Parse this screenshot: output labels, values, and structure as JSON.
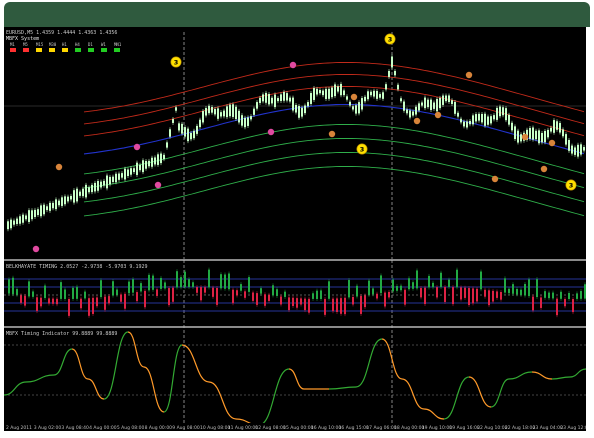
{
  "window": {
    "titlebar_color": "#2f5a3e"
  },
  "main_chart": {
    "symbol_line": "EURUSD,M5  1.4359 1.4444 1.4363 1.4356",
    "indicator_name": "MBFX System",
    "timeframes": [
      "M1",
      "M5",
      "M15",
      "M30",
      "H1",
      "H4",
      "D1",
      "W1",
      "MN1"
    ],
    "timeframe_colors": [
      "#ff3030",
      "#ff3030",
      "#ffd700",
      "#ffd700",
      "#ffd700",
      "#22cc22",
      "#22cc22",
      "#22cc22",
      "#22cc22"
    ],
    "number_marker": "3",
    "colors": {
      "price_bar": "#c8ffc8",
      "red_band": "#c02a1a",
      "green_band": "#2fae4a",
      "blue_mid": "#2233cc",
      "marker_pink": "#e04aa0",
      "marker_orange": "#d8843a",
      "marker_yellow": "#ffe000"
    }
  },
  "middle_panel": {
    "title": "BELKHAYATE TIMING  2.0527  -2.9738  -5.9703  9.1929",
    "colors": {
      "up": "#22aa44",
      "down": "#dd2244",
      "band": "#3344cc"
    }
  },
  "bottom_panel": {
    "title": "MBFX Timing Indicator  99.8889  99.8889",
    "colors": {
      "up": "#33aa33",
      "down": "#ff9a2a"
    }
  },
  "x_axis": {
    "labels": [
      "2 Aug 2011",
      "3 Aug 02:00",
      "3 Aug 08:40",
      "4 Aug 00:00",
      "5 Aug 08:00",
      "8 Aug 00:00",
      "9 Aug 08:00",
      "10 Aug 08:00",
      "11 Aug 00:00",
      "12 Aug 08:00",
      "15 Aug 00:00",
      "16 Aug 10:00",
      "16 Aug 15:00",
      "17 Aug 06:00",
      "18 Aug 00:00",
      "19 Aug 10:00",
      "19 Aug 16:00",
      "22 Aug 10:00",
      "22 Aug 18:00",
      "23 Aug 04:00",
      "23 Aug 12:00"
    ]
  }
}
